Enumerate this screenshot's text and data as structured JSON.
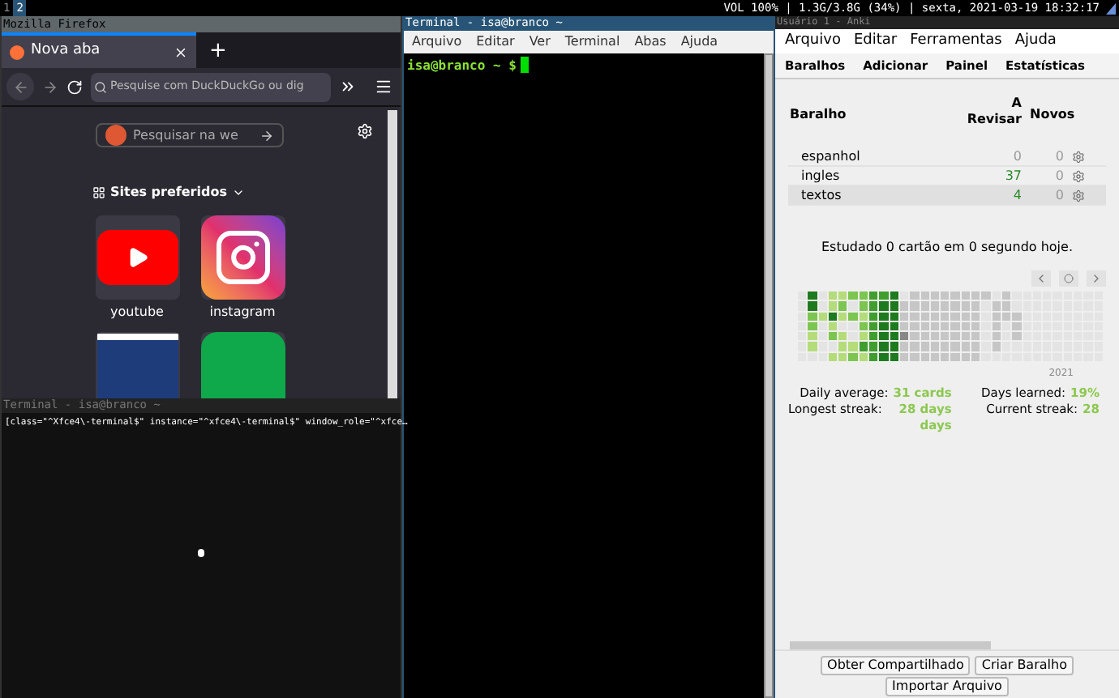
{
  "top_bar": {
    "workspaces": [
      {
        "label": "1",
        "selected": false
      },
      {
        "label": "2",
        "selected": true
      }
    ],
    "status": "VOL 100% | 1.3G/3.8G (34%) | sexta, 2021-03-19 18:32:17"
  },
  "firefox": {
    "title": "Mozilla Firefox",
    "tab": {
      "label": "Nova aba"
    },
    "new_tab": "+",
    "url": {
      "placeholder": "Pesquise com DuckDuckGo ou dig"
    },
    "search": {
      "placeholder": "Pesquisar na we"
    },
    "sites_heading": "Sites preferidos",
    "sites": [
      {
        "kind": "youtube",
        "label": "youtube"
      },
      {
        "kind": "instagram",
        "label": "instagram"
      },
      {
        "kind": "screenshot"
      },
      {
        "kind": "green"
      }
    ]
  },
  "terminal_bottom": {
    "title": "Terminal - isa@branco ~",
    "line": "[class=\"^Xfce4\\-terminal$\" instance=\"^xfce4\\-terminal$\" window_role=\"^xfce…"
  },
  "terminal": {
    "title": "Terminal - isa@branco ~",
    "menu": [
      "Arquivo",
      "Editar",
      "Ver",
      "Terminal",
      "Abas",
      "Ajuda"
    ],
    "prompt": "isa@branco ~ $"
  },
  "anki": {
    "title": "Usuário 1 - Anki",
    "menu": [
      "Arquivo",
      "Editar",
      "Ferramentas",
      "Ajuda"
    ],
    "toolbar": [
      "Baralhos",
      "Adicionar",
      "Painel",
      "Estatísticas"
    ],
    "columns": [
      "Baralho",
      "A Revisar",
      "Novos"
    ],
    "decks": [
      {
        "name": "espanhol",
        "review": "0",
        "new": "0",
        "current": false
      },
      {
        "name": "ingles",
        "review": "37",
        "new": "0",
        "current": false
      },
      {
        "name": "textos",
        "review": "4",
        "new": "0",
        "current": true
      }
    ],
    "studied": "Estudado 0 cartão em 0 segundo hoje.",
    "year": "2021",
    "stats": [
      {
        "label": "Daily average:",
        "value": "31 cards"
      },
      {
        "label": "Days learned:",
        "value": "19%"
      },
      {
        "label": "Longest streak:",
        "value": "28 days days"
      },
      {
        "label": "Current streak:",
        "value": "28"
      }
    ],
    "buttons": [
      "Obter Compartilhado",
      "Criar Baralho",
      "Importar Arquivo"
    ]
  }
}
